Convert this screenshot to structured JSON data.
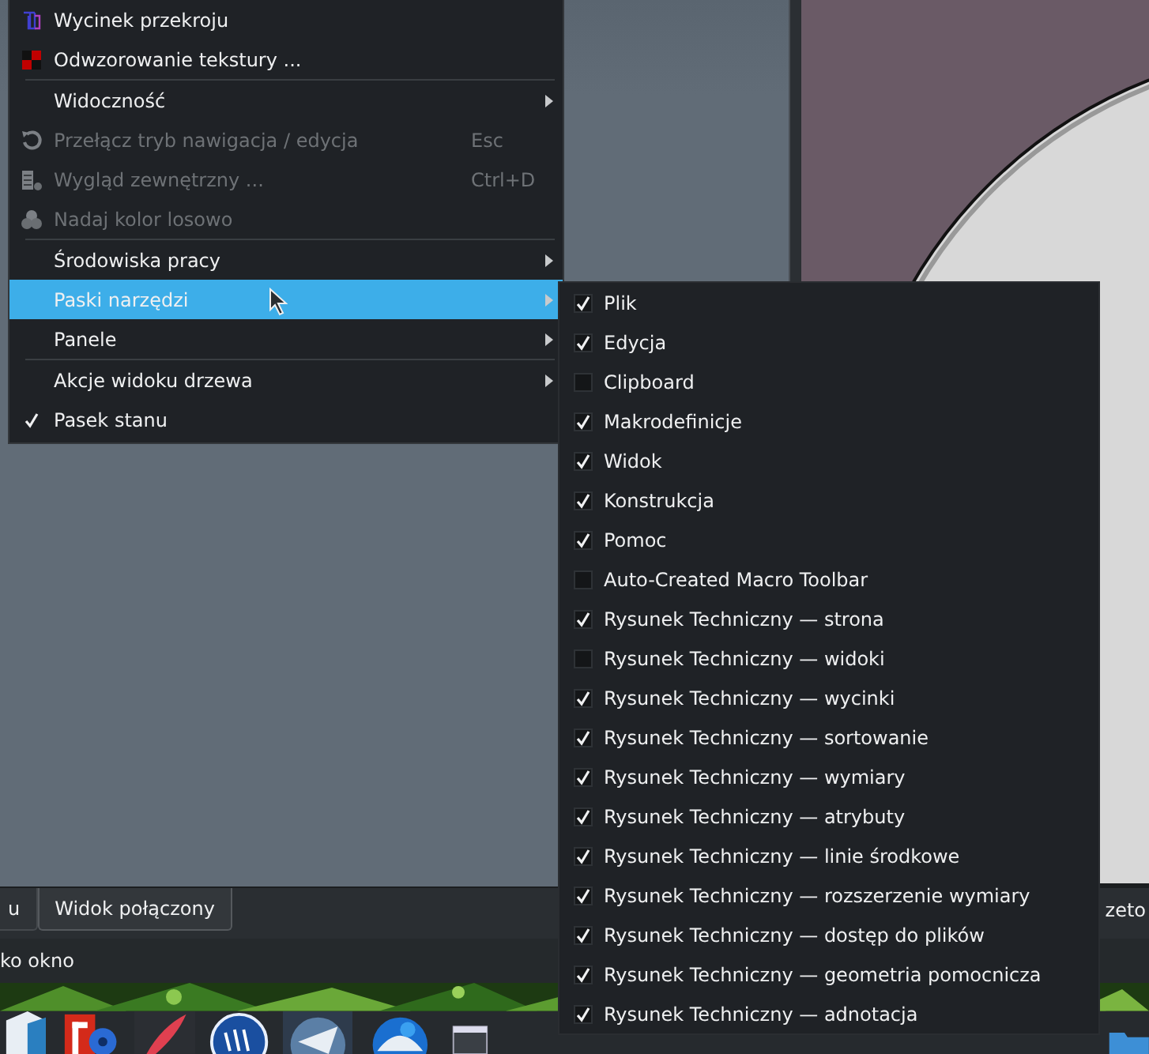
{
  "menu": {
    "items": [
      {
        "kind": "action",
        "label": "Wycinek przekroju",
        "disabled": false,
        "selected": false
      },
      {
        "kind": "action",
        "label": "Odwzorowanie tekstury ...",
        "disabled": false,
        "selected": false
      },
      {
        "kind": "separator"
      },
      {
        "kind": "submenu",
        "label": "Widoczność",
        "disabled": false,
        "selected": false
      },
      {
        "kind": "action",
        "label": "Przełącz tryb nawigacja / edycja",
        "shortcut": "Esc",
        "disabled": true,
        "selected": false
      },
      {
        "kind": "action",
        "label": "Wygląd zewnętrzny ...",
        "shortcut": "Ctrl+D",
        "disabled": true,
        "selected": false
      },
      {
        "kind": "action",
        "label": "Nadaj kolor losowo",
        "disabled": true,
        "selected": false
      },
      {
        "kind": "separator"
      },
      {
        "kind": "submenu",
        "label": "Środowiska pracy",
        "disabled": false,
        "selected": false
      },
      {
        "kind": "submenu",
        "label": "Paski narzędzi",
        "disabled": false,
        "selected": true
      },
      {
        "kind": "submenu",
        "label": "Panele",
        "disabled": false,
        "selected": false
      },
      {
        "kind": "separator"
      },
      {
        "kind": "submenu",
        "label": "Akcje widoku drzewa",
        "disabled": false,
        "selected": false
      },
      {
        "kind": "check",
        "label": "Pasek stanu",
        "checked": true,
        "disabled": false,
        "selected": false
      }
    ]
  },
  "submenu": {
    "items": [
      {
        "label": "Plik",
        "checked": true
      },
      {
        "label": "Edycja",
        "checked": true
      },
      {
        "label": "Clipboard",
        "checked": false
      },
      {
        "label": "Makrodefinicje",
        "checked": true
      },
      {
        "label": "Widok",
        "checked": true
      },
      {
        "label": "Konstrukcja",
        "checked": true
      },
      {
        "label": "Pomoc",
        "checked": true
      },
      {
        "label": "Auto-Created Macro Toolbar",
        "checked": false
      },
      {
        "label": "Rysunek Techniczny — strona",
        "checked": true
      },
      {
        "label": "Rysunek Techniczny — widoki",
        "checked": false
      },
      {
        "label": "Rysunek Techniczny — wycinki",
        "checked": true
      },
      {
        "label": "Rysunek Techniczny — sortowanie",
        "checked": true
      },
      {
        "label": "Rysunek Techniczny — wymiary",
        "checked": true
      },
      {
        "label": "Rysunek Techniczny — atrybuty",
        "checked": true
      },
      {
        "label": "Rysunek Techniczny — linie środkowe",
        "checked": true
      },
      {
        "label": "Rysunek Techniczny — rozszerzenie wymiary",
        "checked": true
      },
      {
        "label": "Rysunek Techniczny — dostęp do plików",
        "checked": true
      },
      {
        "label": "Rysunek Techniczny — geometria pomocnicza",
        "checked": true
      },
      {
        "label": "Rysunek Techniczny — adnotacja",
        "checked": true
      }
    ]
  },
  "view_tabs": [
    {
      "label": "u",
      "selected": false
    },
    {
      "label": "Widok połączony",
      "selected": true
    }
  ],
  "right_tab": {
    "label": "zeto"
  },
  "status_bar": {
    "text": "ko okno"
  }
}
